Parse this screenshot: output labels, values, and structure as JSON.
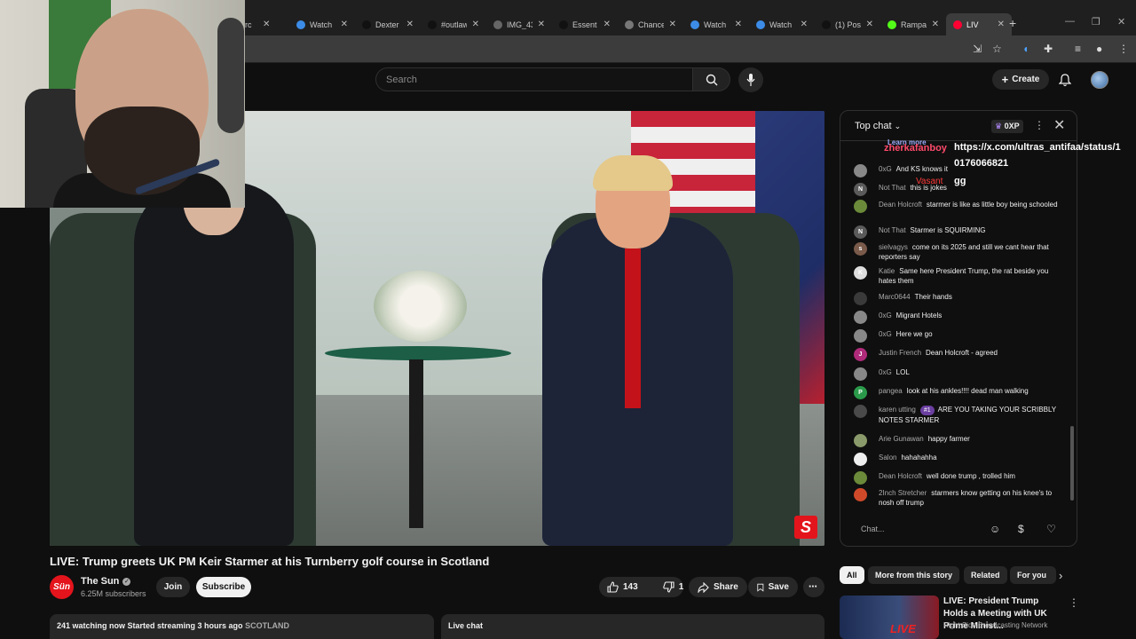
{
  "browser": {
    "tabs": [
      {
        "label": "rc",
        "icon": "generic-tab-icon",
        "color": "#5f6368"
      },
      {
        "label": "Watch",
        "icon": "globe-icon",
        "color": "#3c8ce7"
      },
      {
        "label": "Dexter",
        "icon": "tiktok-icon",
        "color": "#111111"
      },
      {
        "label": "#outlaw",
        "icon": "tiktok-icon",
        "color": "#111111"
      },
      {
        "label": "IMG_43",
        "icon": "globe-icon",
        "color": "#666666"
      },
      {
        "label": "Essent",
        "icon": "tiktok-icon",
        "color": "#111111"
      },
      {
        "label": "Chance",
        "icon": "globe-icon",
        "color": "#777777"
      },
      {
        "label": "Watch",
        "icon": "globe-icon",
        "color": "#3c8ce7"
      },
      {
        "label": "Watch",
        "icon": "globe-icon",
        "color": "#3c8ce7"
      },
      {
        "label": "(1) Pos",
        "icon": "x-icon",
        "color": "#111111"
      },
      {
        "label": "Rampa",
        "icon": "kick-icon",
        "color": "#53fc18"
      },
      {
        "label": "LIV",
        "icon": "youtube-icon",
        "color": "#ff0033"
      }
    ],
    "new_tab_symbol": "+"
  },
  "youtube": {
    "search_placeholder": "Search",
    "create_label": "Create"
  },
  "video": {
    "title": "LIVE: Trump greets UK PM Keir Starmer at his Turnberry golf course in Scotland",
    "overlay_logo": "S"
  },
  "channel": {
    "avatar_text": "Sün",
    "name": "The Sun",
    "subscribers": "6.25M subscribers",
    "join_label": "Join",
    "subscribe_label": "Subscribe"
  },
  "actions": {
    "likes": "143",
    "dislikes": "1",
    "share_label": "Share",
    "save_label": "Save"
  },
  "description": {
    "text": "241 watching now  Started streaming 3 hours ago",
    "tag": "SCOTLAND"
  },
  "livechat_toggle": "Live chat",
  "chat": {
    "title": "Top chat",
    "xp": "0XP",
    "input_placeholder": "Chat...",
    "messages": [
      {
        "author": "0xG",
        "text": "And KS knows it",
        "avatar": "",
        "color": "#888888"
      },
      {
        "author": "Not That",
        "text": "this is jokes",
        "avatar": "N",
        "color": "#5a5a5a"
      },
      {
        "author": "Dean Holcroft",
        "text": "starmer is like as little boy being schooled",
        "avatar": "",
        "color": "#6b8a3a"
      },
      {
        "author": "Not That",
        "text": "Starmer is SQUIRMING",
        "avatar": "N",
        "color": "#5a5a5a"
      },
      {
        "author": "sielvagys",
        "text": "come on its 2025 and still we cant hear that reporters say",
        "avatar": "s",
        "color": "#7a5a4a"
      },
      {
        "author": "Katie",
        "text": "Same here President Trump, the rat beside you hates them",
        "avatar": "K",
        "color": "#dddddd"
      },
      {
        "author": "Marc0644",
        "text": "Their hands",
        "avatar": "",
        "color": "#3a3a3a"
      },
      {
        "author": "0xG",
        "text": "Migrant Hotels",
        "avatar": "",
        "color": "#888888"
      },
      {
        "author": "0xG",
        "text": "Here we go",
        "avatar": "",
        "color": "#888888"
      },
      {
        "author": "Justin French",
        "text": "Dean Holcroft - agreed",
        "avatar": "J",
        "color": "#b02a7a"
      },
      {
        "author": "0xG",
        "text": "LOL",
        "avatar": "",
        "color": "#888888"
      },
      {
        "author": "pangea",
        "text": "look at his ankles!!!! dead man walking",
        "avatar": "P",
        "color": "#2a9a4a"
      },
      {
        "author": "karen utting",
        "badge": "#1",
        "text": "ARE YOU TAKING YOUR SCRIBBLY NOTES STARMER",
        "avatar": "",
        "color": "#4a4a4a"
      },
      {
        "author": "Arie Gunawan",
        "text": "happy farmer",
        "avatar": "",
        "color": "#8a9a6a"
      },
      {
        "author": "Salon",
        "text": "hahahahha",
        "avatar": "",
        "color": "#eeeeee"
      },
      {
        "author": "Dean Holcroft",
        "text": "well done trump , trolled him",
        "avatar": "",
        "color": "#6b8a3a"
      },
      {
        "author": "2Inch Stretcher",
        "text": "starmers know getting on his knee's to nosh off trump",
        "avatar": "",
        "color": "#d04a2a"
      }
    ]
  },
  "stream_overlay": {
    "learn_more": "Learn more",
    "user1": "zherkafanboy",
    "url_text": "https://x.com/ultras_antifaa/status/1",
    "number_text": "0176066821",
    "user2": "Vasant",
    "msg2": "gg"
  },
  "related": {
    "chips": [
      "All",
      "More from this story",
      "Related",
      "For you"
    ],
    "rec_title": "LIVE: President Trump Holds a Meeting with UK Prime Minist...",
    "rec_channel": "Right Side Broadcasting Network",
    "rec_badge": "LIVE"
  }
}
